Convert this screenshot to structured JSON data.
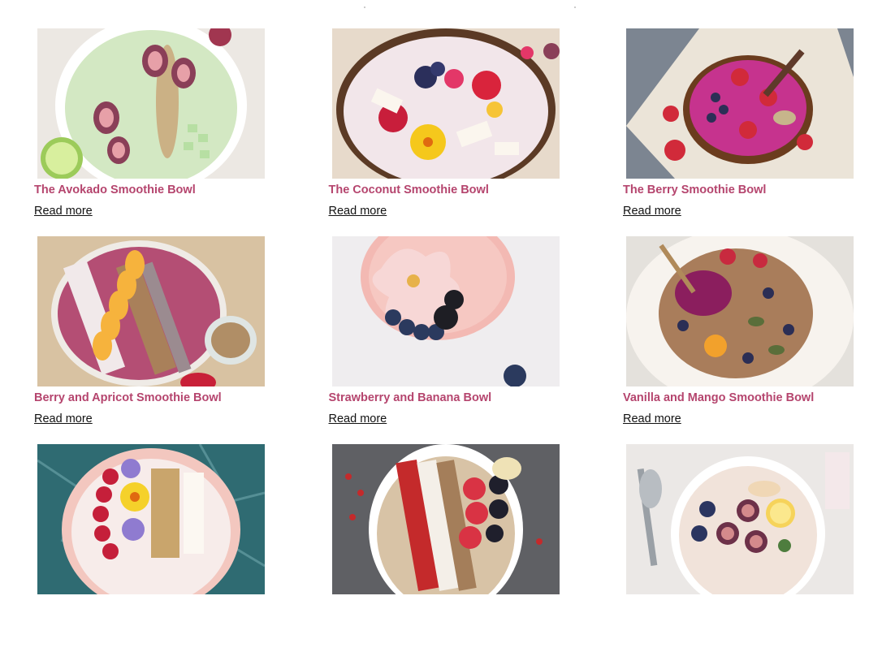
{
  "cards": [
    {
      "title": "The Avokado Smoothie Bowl",
      "link": "Read more"
    },
    {
      "title": "The Coconut Smoothie Bowl",
      "link": "Read more"
    },
    {
      "title": "The Berry Smoothie Bowl",
      "link": "Read more"
    },
    {
      "title": "Berry and Apricot Smoothie Bowl",
      "link": "Read more"
    },
    {
      "title": "Strawberry and Banana Bowl",
      "link": "Read more"
    },
    {
      "title": "Vanilla and Mango Smoothie Bowl",
      "link": "Read more"
    },
    {
      "title": "",
      "link": ""
    },
    {
      "title": "",
      "link": ""
    },
    {
      "title": "",
      "link": ""
    }
  ],
  "colors": {
    "title": "#b5456e",
    "link": "#111111"
  }
}
